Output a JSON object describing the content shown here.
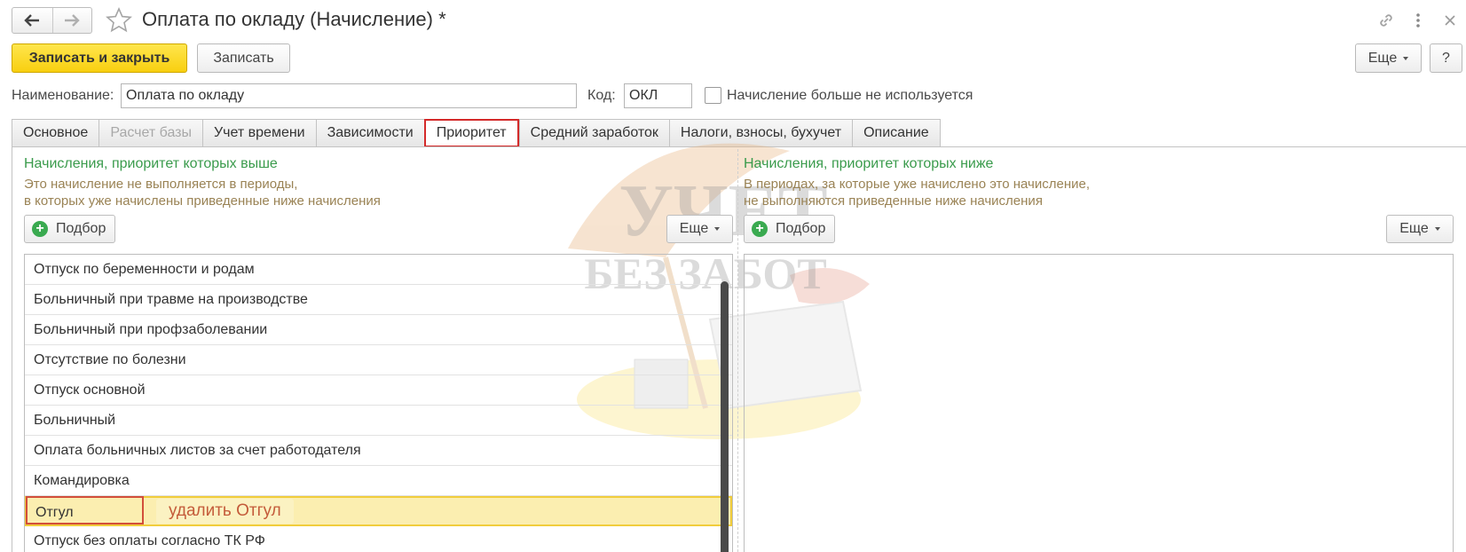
{
  "window": {
    "title": "Оплата по окладу (Начисление) *"
  },
  "toolbar": {
    "save_close_label": "Записать и закрыть",
    "save_label": "Записать",
    "more_label": "Еще",
    "help_label": "?"
  },
  "fields": {
    "name_label": "Наименование:",
    "name_value": "Оплата по окладу",
    "code_label": "Код:",
    "code_value": "ОКЛ",
    "not_used_label": "Начисление больше не используется",
    "not_used_checked": false
  },
  "tabs": [
    {
      "label": "Основное",
      "state": "normal"
    },
    {
      "label": "Расчет базы",
      "state": "disabled"
    },
    {
      "label": "Учет времени",
      "state": "normal"
    },
    {
      "label": "Зависимости",
      "state": "normal"
    },
    {
      "label": "Приоритет",
      "state": "active"
    },
    {
      "label": "Средний заработок",
      "state": "normal"
    },
    {
      "label": "Налоги, взносы, бухучет",
      "state": "normal"
    },
    {
      "label": "Описание",
      "state": "normal"
    }
  ],
  "left_panel": {
    "title": "Начисления, приоритет которых выше",
    "desc_line1": "Это начисление не выполняется в периоды,",
    "desc_line2": "в которых уже начислены приведенные ниже начисления",
    "pick_label": "Подбор",
    "more_label": "Еще",
    "items": [
      "Отпуск по беременности и родам",
      "Больничный при травме на производстве",
      "Больничный при профзаболевании",
      "Отсутствие по болезни",
      "Отпуск основной",
      "Больничный",
      "Оплата больничных листов за счет работодателя",
      "Командировка",
      "Отгул",
      "Отпуск без оплаты согласно ТК РФ"
    ],
    "selected_index": 8
  },
  "right_panel": {
    "title": "Начисления, приоритет которых ниже",
    "desc_line1": "В периодах, за которые уже начислено это начисление,",
    "desc_line2": "не выполняются приведенные ниже начисления",
    "pick_label": "Подбор",
    "more_label": "Еще"
  },
  "annotation": {
    "text": "удалить Отгул"
  },
  "watermark": {
    "line1": "УЧЕТ",
    "line2": "БЕЗ ЗАБОТ"
  },
  "colors": {
    "primary_button": "#f8d42c",
    "active_tab_border": "#d42a2a",
    "section_title": "#3a9b4c",
    "section_desc": "#9a8355",
    "selection_fill": "#fbeeb0",
    "annotation_text": "#c45b3a"
  },
  "icons": {
    "back": "arrow-left-icon",
    "forward": "arrow-right-icon",
    "favorite": "star-icon",
    "link": "link-icon",
    "menu": "kebab-menu-icon",
    "close": "close-icon",
    "pick": "plus-circle-icon"
  }
}
